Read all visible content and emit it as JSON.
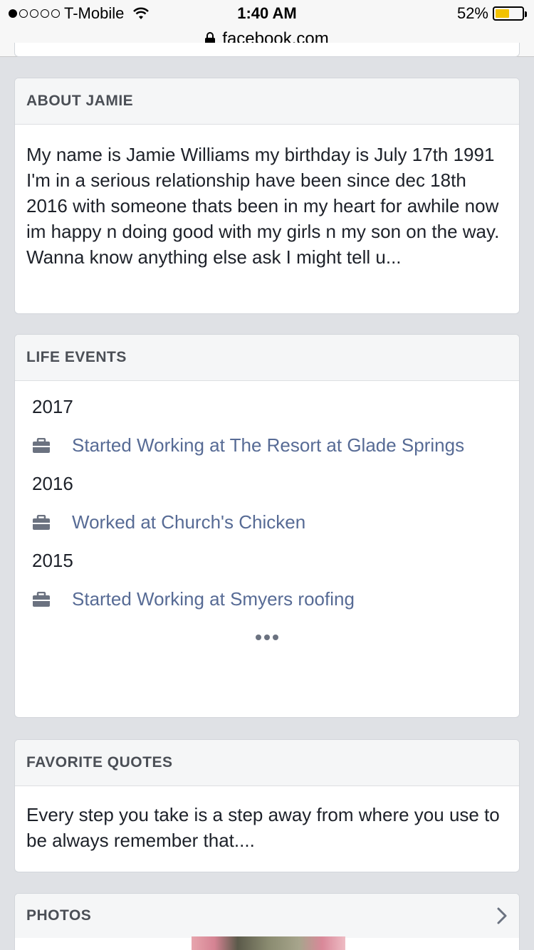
{
  "status_bar": {
    "carrier": "T-Mobile",
    "time": "1:40 AM",
    "battery_percent": "52%",
    "battery_level": 0.52,
    "signal_bars_filled": 1,
    "signal_bars_total": 5
  },
  "url_bar": {
    "domain": "facebook.com"
  },
  "about": {
    "title": "ABOUT JAMIE",
    "text": "My name is Jamie Williams my birthday is July 17th 1991 I'm in a serious relationship have been since dec 18th 2016 with someone thats been in my heart for awhile now im happy n doing good with my girls n my son on the way. Wanna know anything else ask I might tell u..."
  },
  "life_events": {
    "title": "LIFE EVENTS",
    "groups": [
      {
        "year": "2017",
        "event": "Started Working at The Resort at Glade Springs",
        "icon": "briefcase-icon"
      },
      {
        "year": "2016",
        "event": "Worked at Church's Chicken",
        "icon": "briefcase-icon"
      },
      {
        "year": "2015",
        "event": "Started Working at Smyers roofing",
        "icon": "briefcase-icon"
      }
    ]
  },
  "favorite_quotes": {
    "title": "FAVORITE QUOTES",
    "text": "Every step you take is a step away from where you use to be always remember that...."
  },
  "photos": {
    "title": "PHOTOS"
  },
  "colors": {
    "link": "#576b95",
    "background": "#dfe1e5",
    "header_bg": "#f5f6f7",
    "battery": "#f2c200"
  }
}
